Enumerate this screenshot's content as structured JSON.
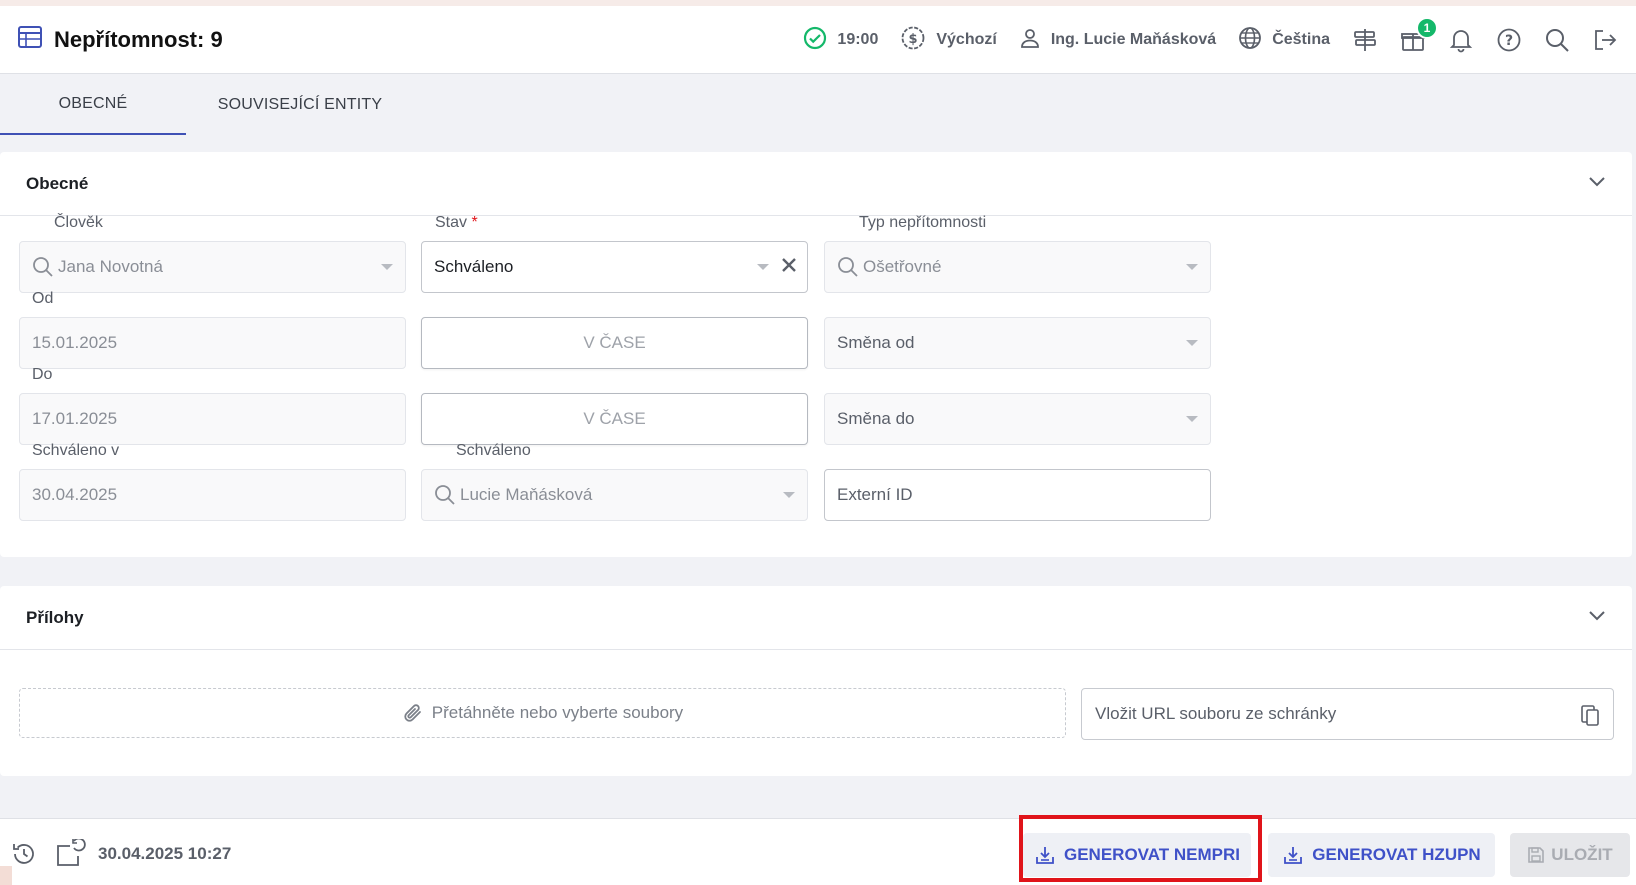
{
  "header": {
    "title": "Nepřítomnost: 9",
    "time": "19:00",
    "currency": "Výchozí",
    "user": "Ing. Lucie Maňásková",
    "language": "Čeština",
    "gift_badge": "1"
  },
  "tabs": [
    {
      "label": "OBECNÉ"
    },
    {
      "label": "SOUVISEJÍCÍ ENTITY"
    }
  ],
  "general": {
    "title": "Obecné",
    "person": {
      "label": "Člověk",
      "value": "Jana Novotná"
    },
    "status": {
      "label": "Stav",
      "required": "*",
      "value": "Schváleno"
    },
    "absence_type": {
      "label": "Typ nepřítomnosti",
      "value": "Ošetřovné"
    },
    "from": {
      "label": "Od",
      "value": "15.01.2025"
    },
    "to": {
      "label": "Do",
      "value": "17.01.2025"
    },
    "in_time_from": "V ČASE",
    "in_time_to": "V ČASE",
    "shift_from": {
      "placeholder": "Směna od"
    },
    "shift_to": {
      "placeholder": "Směna do"
    },
    "approved_at": {
      "label": "Schváleno v",
      "value": "30.04.2025"
    },
    "approved_by": {
      "label": "Schváleno",
      "value": "Lucie Maňásková"
    },
    "external_id": {
      "placeholder": "Externí ID"
    }
  },
  "attachments": {
    "title": "Přílohy",
    "drop_text": "Přetáhněte nebo vyberte soubory",
    "url_placeholder": "Vložit URL souboru ze schránky"
  },
  "footer": {
    "timestamp": "30.04.2025 10:27",
    "btn_nempri": "GENEROVAT NEMPRI",
    "btn_hzupn": "GENEROVAT HZUPN",
    "btn_save": "ULOŽIT"
  },
  "colors": {
    "accent": "#3f51b5",
    "ok_green": "#14b86a",
    "highlight_red": "#e0141a"
  }
}
